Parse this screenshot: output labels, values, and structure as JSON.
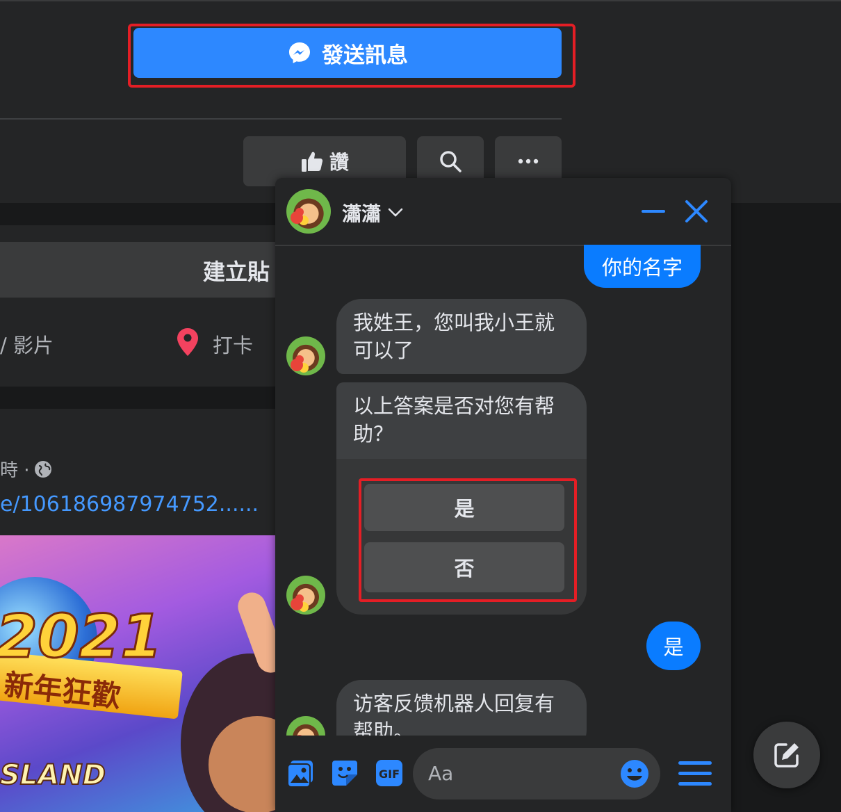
{
  "page": {
    "send_message_button": "發送訊息",
    "like_button": "讚",
    "composer": {
      "create_post": "建立貼",
      "photo_video": "  / 影片",
      "checkin": "打卡"
    },
    "post": {
      "meta": "時 ·",
      "link": "e/106186987974752......",
      "image_text_year": "2021",
      "image_text_cn": "新年狂歡",
      "image_text_brand": "SLAND"
    }
  },
  "chat": {
    "contact_name": "瀟瀟",
    "messages": [
      {
        "from": "me",
        "text": "你的名字"
      },
      {
        "from": "them",
        "line1": "我姓王，您叫我小王就",
        "line2": "可以了"
      },
      {
        "from": "them",
        "line1": "以上答案是否对您有帮",
        "line2": "助？",
        "quick_replies": [
          "是",
          "否"
        ]
      },
      {
        "from": "me",
        "text": "是"
      },
      {
        "from": "them",
        "line1": "访客反馈机器人回复有",
        "line2": "帮助。"
      }
    ],
    "input_placeholder": "Aa"
  },
  "colors": {
    "accent": "#2d88ff",
    "highlight": "#e41e25",
    "outgoing_bubble": "#0a7cff",
    "incoming_bubble": "#3e4042",
    "background": "#18191a",
    "surface": "#242526"
  },
  "icons": [
    "messenger-icon",
    "thumbs-up-icon",
    "search-icon",
    "more-icon",
    "location-pin-icon",
    "globe-icon",
    "chevron-down-icon",
    "minimize-icon",
    "close-icon",
    "photo-icon",
    "sticker-icon",
    "gif-icon",
    "emoji-icon",
    "menu-icon",
    "compose-icon"
  ]
}
